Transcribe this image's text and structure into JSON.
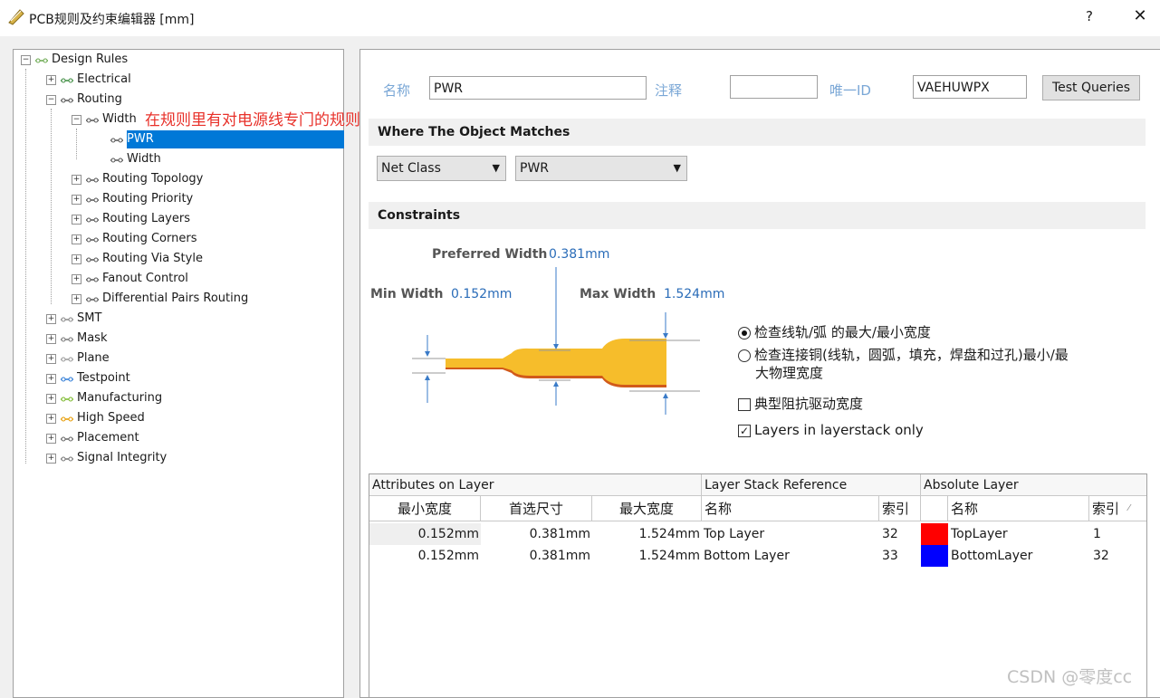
{
  "window": {
    "title": "PCB规则及约束编辑器 [mm]",
    "help_label": "?",
    "close_label": "✕"
  },
  "tree": {
    "items": [
      {
        "label": "Design Rules",
        "icon": "design-rules-icon",
        "expander": "⊟"
      },
      {
        "label": "Electrical",
        "icon": "electrical-icon",
        "expander": "⊞"
      },
      {
        "label": "Routing",
        "icon": "routing-icon",
        "expander": "⊟"
      },
      {
        "label": "Width",
        "icon": "width-rule-icon",
        "expander": "⊟"
      },
      {
        "label": "PWR",
        "icon": "rule-icon",
        "expander": ""
      },
      {
        "label": "Width",
        "icon": "rule-icon",
        "expander": ""
      },
      {
        "label": "Routing Topology",
        "icon": "routing-rule-icon",
        "expander": "⊞"
      },
      {
        "label": "Routing Priority",
        "icon": "routing-rule-icon",
        "expander": "⊞"
      },
      {
        "label": "Routing Layers",
        "icon": "routing-rule-icon",
        "expander": "⊞"
      },
      {
        "label": "Routing Corners",
        "icon": "routing-rule-icon",
        "expander": "⊞"
      },
      {
        "label": "Routing Via Style",
        "icon": "routing-rule-icon",
        "expander": "⊞"
      },
      {
        "label": "Fanout Control",
        "icon": "routing-rule-icon",
        "expander": "⊞"
      },
      {
        "label": "Differential Pairs Routing",
        "icon": "routing-rule-icon",
        "expander": "⊞"
      },
      {
        "label": "SMT",
        "icon": "smt-icon",
        "expander": "⊞"
      },
      {
        "label": "Mask",
        "icon": "mask-icon",
        "expander": "⊞"
      },
      {
        "label": "Plane",
        "icon": "plane-icon",
        "expander": "⊞"
      },
      {
        "label": "Testpoint",
        "icon": "testpoint-icon",
        "expander": "⊞"
      },
      {
        "label": "Manufacturing",
        "icon": "manufacturing-icon",
        "expander": "⊞"
      },
      {
        "label": "High Speed",
        "icon": "high-speed-icon",
        "expander": "⊞"
      },
      {
        "label": "Placement",
        "icon": "placement-icon",
        "expander": "⊞"
      },
      {
        "label": "Signal Integrity",
        "icon": "signal-integrity-icon",
        "expander": "⊞"
      }
    ],
    "selected": "PWR",
    "annotation": "在规则里有对电源线专门的规则"
  },
  "rule": {
    "name_label": "名称",
    "name_value": "PWR",
    "comment_label": "注释",
    "comment_value": "",
    "uid_label": "唯一ID",
    "uid_value": "VAEHUWPX",
    "test_queries": "Test Queries"
  },
  "where": {
    "header": "Where The Object Matches",
    "type_value": "Net Class",
    "net_value": "PWR"
  },
  "constraints": {
    "header": "Constraints",
    "preferred_label": "Preferred Width",
    "preferred_value": "0.381mm",
    "min_label": "Min Width",
    "min_value": "0.152mm",
    "max_label": "Max Width",
    "max_value": "1.524mm",
    "radio1": "检查线轨/弧 的最大/最小宽度",
    "radio2_line1": "检查连接铜(线轨，圆弧，填充，焊盘和过孔)最小/最",
    "radio2_line2": "大物理宽度",
    "radio_selected": 1,
    "check1": "典型阻抗驱动宽度",
    "check1_checked": false,
    "check2": "Layers in layerstack only",
    "check2_checked": true
  },
  "grid": {
    "group_headers": [
      "Attributes on Layer",
      "Layer Stack Reference",
      "Absolute Layer"
    ],
    "columns": [
      "最小宽度",
      "首选尺寸",
      "最大宽度",
      "名称",
      "索引",
      "名称",
      "索引"
    ],
    "rows": [
      {
        "min": "0.152mm",
        "pref": "0.381mm",
        "max": "1.524mm",
        "stack_name": "Top Layer",
        "stack_idx": "32",
        "color": "#ff0000",
        "abs_name": "TopLayer",
        "abs_idx": "1"
      },
      {
        "min": "0.152mm",
        "pref": "0.381mm",
        "max": "1.524mm",
        "stack_name": "Bottom Layer",
        "stack_idx": "33",
        "color": "#0000ff",
        "abs_name": "BottomLayer",
        "abs_idx": "32"
      }
    ]
  },
  "watermark": "CSDN @零度cc"
}
